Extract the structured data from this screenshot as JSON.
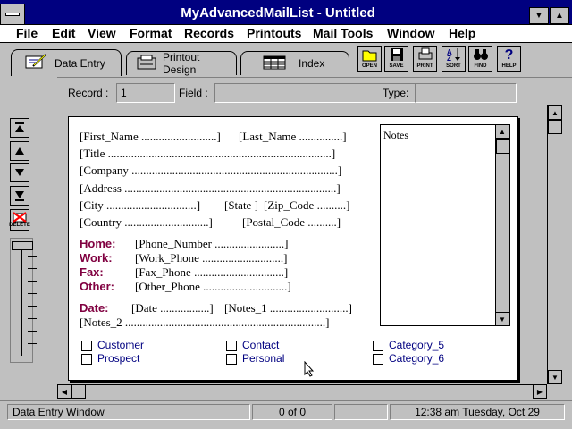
{
  "window": {
    "title": "MyAdvancedMailList - Untitled",
    "minimize_glyph": "▼",
    "maximize_glyph": "▲"
  },
  "menu": [
    {
      "label": "File"
    },
    {
      "label": "Edit"
    },
    {
      "label": "View"
    },
    {
      "label": "Format"
    },
    {
      "label": "Records"
    },
    {
      "label": "Printouts"
    },
    {
      "label": "Mail Tools"
    },
    {
      "label": "Window"
    },
    {
      "label": "Help"
    }
  ],
  "tabs": [
    {
      "label": "Data Entry",
      "icon": "pencil-pad-icon",
      "active": true
    },
    {
      "label": "Printout Design",
      "icon": "printer-page-icon",
      "active": false
    },
    {
      "label": "Index",
      "icon": "grid-table-icon",
      "active": false
    }
  ],
  "toolbar": [
    {
      "label": "OPEN",
      "icon": "folder-open-icon"
    },
    {
      "label": "SAVE",
      "icon": "floppy-icon"
    },
    {
      "label": "PRINT",
      "icon": "printer-icon"
    },
    {
      "label": "SORT",
      "icon": "sort-az-icon"
    },
    {
      "label": "FIND",
      "icon": "binoculars-icon"
    },
    {
      "label": "HELP",
      "icon": "question-icon"
    }
  ],
  "fieldbar": {
    "record_label": "Record :",
    "record_value": "1",
    "field_label": "Field :",
    "field_value": "",
    "type_label": "Type:",
    "type_value": ""
  },
  "nav": {
    "delete_label": "DELETE"
  },
  "form": {
    "first_name": "[First_Name ..........................]",
    "last_name": "[Last_Name ...............]",
    "title": "[Title .............................................................................]",
    "company": "[Company .......................................................................]",
    "address": "[Address .........................................................................]",
    "city": "[City ...............................]",
    "state": "[State ]",
    "zip": "[Zip_Code ..........]",
    "country": "[Country .............................]",
    "postal": "[Postal_Code ..........]",
    "home_label": "Home:",
    "home_field": "[Phone_Number ........................]",
    "work_label": "Work:",
    "work_field": "[Work_Phone ............................]",
    "fax_label": "Fax:",
    "fax_field": "[Fax_Phone ...............................]",
    "other_label": "Other:",
    "other_field": "[Other_Phone .............................]",
    "date_label": "Date:",
    "date_field": "[Date .................]",
    "notes1_field": "[Notes_1 ...........................]",
    "notes2_field": "[Notes_2 .....................................................................]",
    "notes_box_title": "Notes",
    "checkboxes": [
      {
        "label": "Customer"
      },
      {
        "label": "Prospect"
      },
      {
        "label": "Contact"
      },
      {
        "label": "Personal"
      },
      {
        "label": "Category_5"
      },
      {
        "label": "Category_6"
      }
    ]
  },
  "status": {
    "window_name": "Data Entry Window",
    "record_count": "0 of 0",
    "clock": "12:38 am  Tuesday, Oct 29"
  }
}
